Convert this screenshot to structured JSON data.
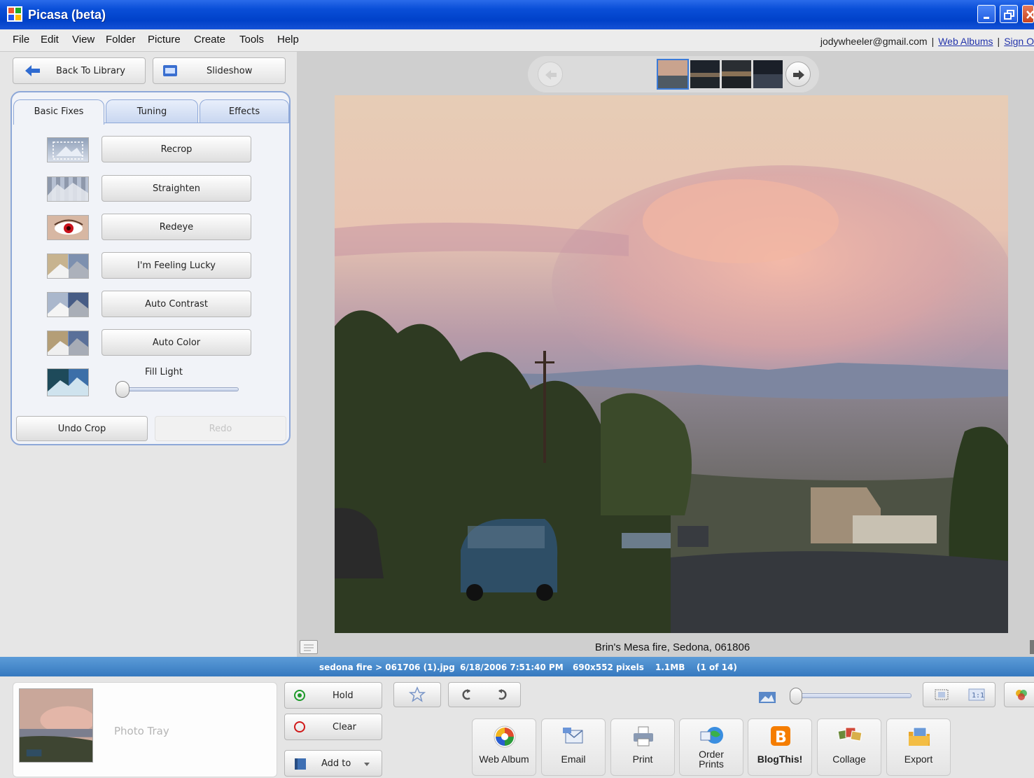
{
  "window": {
    "title": "Picasa (beta)"
  },
  "menu": {
    "items": [
      "File",
      "Edit",
      "View",
      "Folder",
      "Picture",
      "Create",
      "Tools",
      "Help"
    ],
    "account_email": "jodywheeler@gmail.com",
    "web_albums_link": "Web Albums",
    "sign_out_link": "Sign O",
    "separator": "|"
  },
  "left_panel": {
    "back_button": "Back To Library",
    "slideshow_button": "Slideshow",
    "tabs": [
      "Basic Fixes",
      "Tuning",
      "Effects"
    ],
    "active_tab": "Basic Fixes",
    "fixes": [
      "Recrop",
      "Straighten",
      "Redeye",
      "I'm Feeling Lucky",
      "Auto Contrast",
      "Auto Color"
    ],
    "fill_light": {
      "label": "Fill Light",
      "value": 0
    },
    "undo_button": "Undo Crop",
    "redo_button": "Redo"
  },
  "viewer": {
    "caption": "Brin's Mesa fire, Sedona, 061806",
    "filmstrip_count": 4,
    "selected_index": 0
  },
  "status": {
    "path": "sedona fire > 061706 (1).jpg",
    "datetime": "6/18/2006 7:51:40 PM",
    "dimensions": "690x552 pixels",
    "size": "1.1MB",
    "position": "(1 of 14)"
  },
  "tray": {
    "label": "Photo Tray",
    "hold_button": "Hold",
    "clear_button": "Clear",
    "add_to_button": "Add to"
  },
  "actions": {
    "web_album": "Web Album",
    "email": "Email",
    "print": "Print",
    "order_prints_line1": "Order",
    "order_prints_line2": "Prints",
    "blogthis": "BlogThis!",
    "collage": "Collage",
    "export": "Export"
  },
  "colors": {
    "title_bar": "#0a4fd8",
    "status_bar": "#4a8ccc",
    "tab_border": "#8ea8d8"
  }
}
